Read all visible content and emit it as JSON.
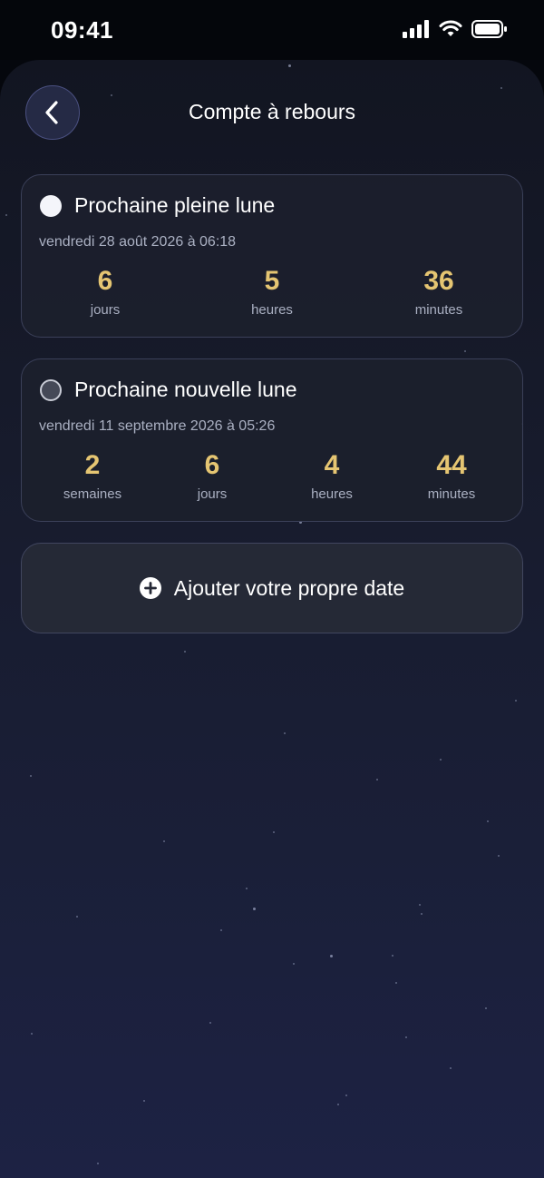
{
  "status_bar": {
    "time": "09:41",
    "icons": [
      "signal-icon",
      "wifi-icon",
      "battery-icon"
    ]
  },
  "header": {
    "title": "Compte à rebours",
    "back_icon": "chevron-left-icon"
  },
  "cards": [
    {
      "title": "Prochaine pleine lune",
      "icon": "full-moon-icon",
      "date": "vendredi 28 août 2026 à 06:18",
      "units": [
        {
          "value": "6",
          "label": "jours"
        },
        {
          "value": "5",
          "label": "heures"
        },
        {
          "value": "36",
          "label": "minutes"
        }
      ]
    },
    {
      "title": "Prochaine nouvelle lune",
      "icon": "new-moon-icon",
      "date": "vendredi 11 septembre 2026 à 05:26",
      "units": [
        {
          "value": "2",
          "label": "semaines"
        },
        {
          "value": "6",
          "label": "jours"
        },
        {
          "value": "4",
          "label": "heures"
        },
        {
          "value": "44",
          "label": "minutes"
        }
      ]
    }
  ],
  "add_button": {
    "label": "Ajouter votre propre date",
    "icon": "plus-circle-icon"
  },
  "colors": {
    "accent": "#e5c572",
    "muted_text": "#aab0c2",
    "card_border": "#3b4059"
  }
}
